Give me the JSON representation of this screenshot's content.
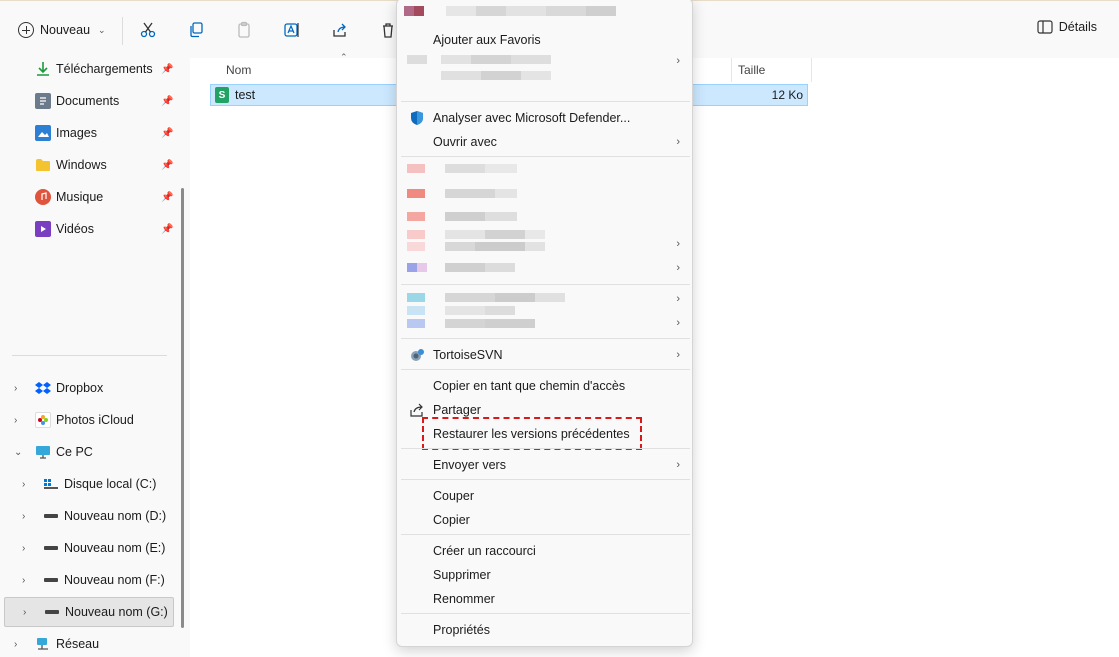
{
  "toolbar": {
    "new_label": "Nouveau",
    "details_label": "Détails"
  },
  "sidebar": {
    "quick_access": [
      {
        "label": "Téléchargements",
        "icon": "download-icon"
      },
      {
        "label": "Documents",
        "icon": "documents-icon"
      },
      {
        "label": "Images",
        "icon": "images-icon"
      },
      {
        "label": "Windows",
        "icon": "folder-icon"
      },
      {
        "label": "Musique",
        "icon": "music-icon"
      },
      {
        "label": "Vidéos",
        "icon": "videos-icon"
      }
    ],
    "locations": [
      {
        "label": "Dropbox",
        "icon": "dropbox-icon"
      },
      {
        "label": "Photos iCloud",
        "icon": "icloud-photos-icon"
      },
      {
        "label": "Ce PC",
        "icon": "pc-icon"
      }
    ],
    "drives": [
      {
        "label": "Disque local (C:)"
      },
      {
        "label": "Nouveau nom (D:)"
      },
      {
        "label": "Nouveau nom (E:)"
      },
      {
        "label": "Nouveau nom (F:)"
      },
      {
        "label": "Nouveau nom (G:)"
      }
    ],
    "network": {
      "label": "Réseau"
    }
  },
  "main": {
    "columns": {
      "name": "Nom",
      "size": "Taille"
    },
    "file": {
      "name": "test",
      "size": "12 Ko"
    }
  },
  "context_menu": {
    "favorites": "Ajouter aux Favoris",
    "defender": "Analyser avec Microsoft Defender...",
    "open_with": "Ouvrir avec",
    "tortoise": "TortoiseSVN",
    "copy_path": "Copier en tant que chemin d'accès",
    "share": "Partager",
    "restore": "Restaurer les versions précédentes",
    "send_to": "Envoyer vers",
    "cut": "Couper",
    "copy": "Copier",
    "shortcut": "Créer un raccourci",
    "delete": "Supprimer",
    "rename": "Renommer",
    "properties": "Propriétés"
  },
  "colors": {
    "selection": "#cce8ff",
    "highlight_border": "#d91a1a",
    "accent": "#0067c0"
  }
}
